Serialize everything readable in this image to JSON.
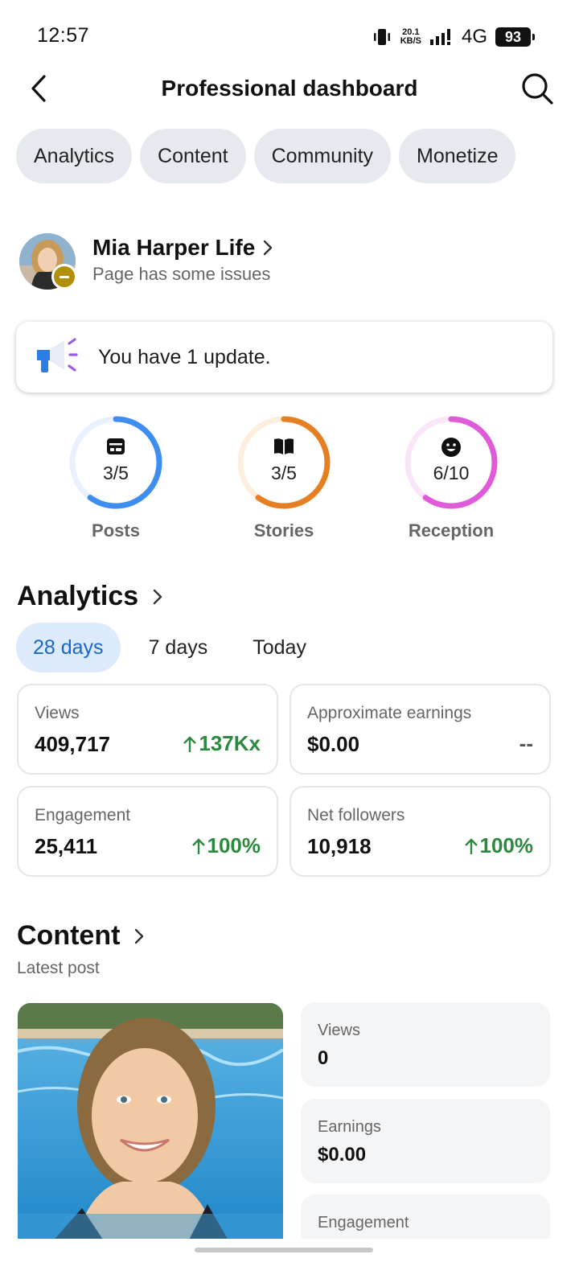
{
  "status": {
    "time": "12:57",
    "net_speed_value": "20.1",
    "net_speed_unit": "KB/S",
    "network": "4G",
    "battery": "93"
  },
  "header": {
    "title": "Professional dashboard"
  },
  "tabs": [
    {
      "label": "Analytics"
    },
    {
      "label": "Content"
    },
    {
      "label": "Community"
    },
    {
      "label": "Monetize"
    }
  ],
  "profile": {
    "name": "Mia Harper Life",
    "status": "Page has some issues"
  },
  "update": {
    "text": "You have 1 update."
  },
  "progress": [
    {
      "label": "Posts",
      "value_text": "3/5",
      "fraction": 0.6,
      "color": "#3d8ef0",
      "track": "#e8f1fd",
      "icon": "post-icon"
    },
    {
      "label": "Stories",
      "value_text": "3/5",
      "fraction": 0.6,
      "color": "#e67e22",
      "track": "#fdeedd",
      "icon": "book-icon"
    },
    {
      "label": "Reception",
      "value_text": "6/10",
      "fraction": 0.6,
      "color": "#e05bd8",
      "track": "#fbe5f9",
      "icon": "smiley-icon"
    }
  ],
  "analytics": {
    "title": "Analytics",
    "periods": [
      {
        "label": "28 days",
        "active": true
      },
      {
        "label": "7 days",
        "active": false
      },
      {
        "label": "Today",
        "active": false
      }
    ],
    "stats": [
      {
        "label": "Views",
        "value": "409,717",
        "change": "137Kx",
        "trend": "up"
      },
      {
        "label": "Approximate earnings",
        "value": "$0.00",
        "change": "--",
        "trend": "none"
      },
      {
        "label": "Engagement",
        "value": "25,411",
        "change": "100%",
        "trend": "up"
      },
      {
        "label": "Net followers",
        "value": "10,918",
        "change": "100%",
        "trend": "up"
      }
    ]
  },
  "content": {
    "title": "Content",
    "subtitle": "Latest post",
    "metrics": [
      {
        "label": "Views",
        "value": "0"
      },
      {
        "label": "Earnings",
        "value": "$0.00"
      },
      {
        "label": "Engagement",
        "value": ""
      }
    ]
  },
  "colors": {
    "accent": "#1a66c9",
    "positive": "#2b8a3e",
    "warning_badge": "#b09008"
  }
}
